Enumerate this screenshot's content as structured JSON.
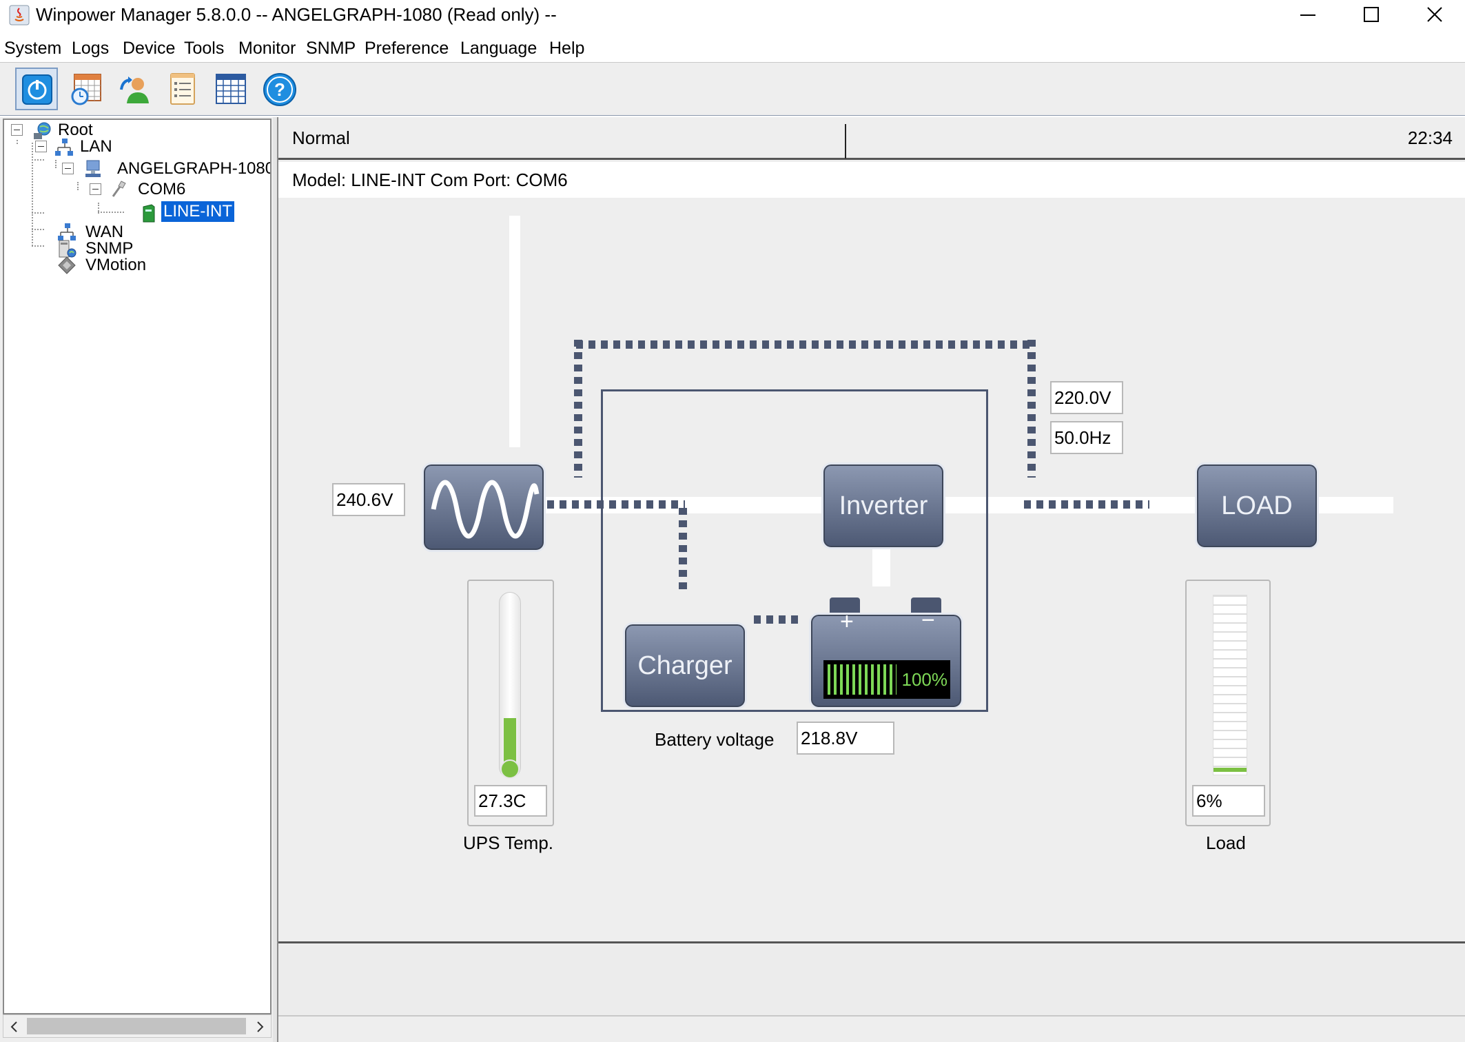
{
  "window": {
    "title": "Winpower Manager 5.8.0.0 -- ANGELGRAPH-1080 (Read only) --"
  },
  "menu": [
    "System",
    "Logs",
    "Device",
    "Tools",
    "Monitor",
    "SNMP",
    "Preference",
    "Language",
    "Help"
  ],
  "toolbar": {
    "buttons": [
      "power-monitor-icon",
      "schedule-icon",
      "user-icon",
      "event-list-icon",
      "data-table-icon",
      "help-icon"
    ]
  },
  "tree": {
    "root": "Root",
    "lan": "LAN",
    "host": "ANGELGRAPH-1080",
    "port": "COM6",
    "device": "LINE-INT",
    "wan": "WAN",
    "snmp": "SNMP",
    "vmotion": "VMotion"
  },
  "status": {
    "state": "Normal",
    "time": "22:34"
  },
  "model_line": "Model: LINE-INT    Com Port: COM6",
  "diagram": {
    "input_voltage": "240.6V",
    "output_voltage": "220.0V",
    "output_frequency": "50.0Hz",
    "inverter_label": "Inverter",
    "charger_label": "Charger",
    "load_block_label": "LOAD",
    "battery_percent": "100%",
    "battery_level": 1.0,
    "battery_voltage_label": "Battery voltage",
    "battery_voltage": "218.8V",
    "ups_temp_value": "27.3C",
    "ups_temp_label": "UPS Temp.",
    "load_value": "6%",
    "load_label": "Load",
    "load_level": 0.06
  },
  "colors": {
    "selection": "#0a64d8",
    "block": "#5b6782",
    "dots": "#4b5670",
    "battery_green": "#7ed957",
    "thermo_green": "#7cc043"
  }
}
